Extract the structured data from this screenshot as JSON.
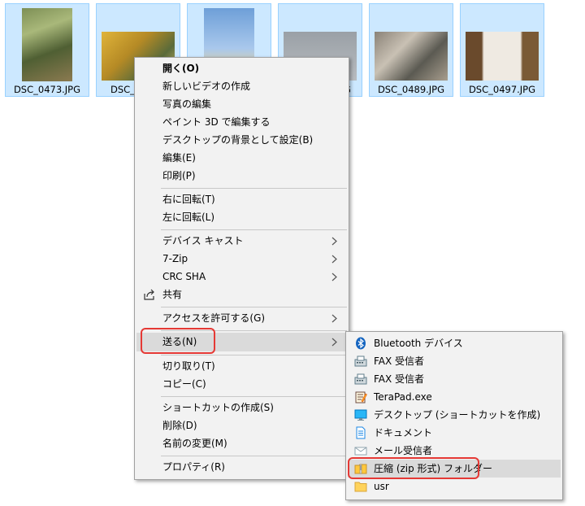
{
  "files": [
    {
      "name": "DSC_0473.JPG"
    },
    {
      "name": "DSC_0"
    },
    {
      "name": ""
    },
    {
      "name": "G"
    },
    {
      "name": "DSC_0489.JPG"
    },
    {
      "name": "DSC_0497.JPG"
    }
  ],
  "context_menu": {
    "items": [
      "開く(O)",
      "新しいビデオの作成",
      "写真の編集",
      "ペイント 3D で編集する",
      "デスクトップの背景として設定(B)",
      "編集(E)",
      "印刷(P)",
      "右に回転(T)",
      "左に回転(L)",
      "デバイス キャスト",
      "7-Zip",
      "CRC SHA",
      "共有",
      "アクセスを許可する(G)",
      "送る(N)",
      "切り取り(T)",
      "コピー(C)",
      "ショートカットの作成(S)",
      "削除(D)",
      "名前の変更(M)",
      "プロパティ(R)"
    ]
  },
  "send_to_menu": {
    "items": [
      "Bluetooth デバイス",
      "FAX 受信者",
      "FAX 受信者",
      "TeraPad.exe",
      "デスクトップ (ショートカットを作成)",
      "ドキュメント",
      "メール受信者",
      "圧縮 (zip 形式) フォルダー",
      "usr"
    ]
  },
  "colors": {
    "selection": "#cce8ff",
    "menu_bg": "#f2f2f2",
    "highlight": "#dadada",
    "annotation_red": "#e53935"
  }
}
